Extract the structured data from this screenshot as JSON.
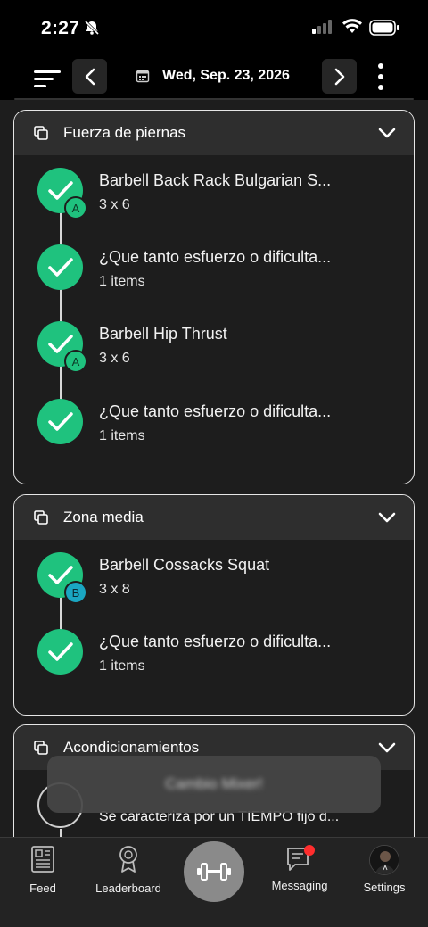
{
  "status_bar": {
    "time": "2:27"
  },
  "nav": {
    "date": "Wed, Sep. 23, 2026"
  },
  "sections": [
    {
      "title": "Fuerza de piernas",
      "exercises": [
        {
          "name": "Barbell Back Rack Bulgarian S...",
          "detail": "3 x 6",
          "badge": "A"
        },
        {
          "name": "¿Que tanto esfuerzo o dificulta...",
          "detail": "1 items",
          "badge": ""
        },
        {
          "name": "Barbell Hip Thrust",
          "detail": "3 x 6",
          "badge": "A"
        },
        {
          "name": "¿Que tanto esfuerzo o dificulta...",
          "detail": "1 items",
          "badge": ""
        }
      ]
    },
    {
      "title": "Zona media",
      "exercises": [
        {
          "name": "Barbell Cossacks Squat",
          "detail": "3 x 8",
          "badge": "B"
        },
        {
          "name": "¿Que tanto esfuerzo o dificulta...",
          "detail": "1 items",
          "badge": ""
        }
      ]
    },
    {
      "title": "Acondicionamientos",
      "exercises": [
        {
          "name": "Se caracteriza por un TIEMPO fijo d...",
          "detail": "",
          "badge": ""
        }
      ]
    }
  ],
  "toast": {
    "text": "Cambio Mixer!"
  },
  "tabbar": {
    "feed": "Feed",
    "leaderboard": "Leaderboard",
    "messaging": "Messaging",
    "settings": "Settings"
  },
  "colors": {
    "accent_green": "#1fc27e",
    "badge_blue": "#1aa6c2",
    "notification_red": "#ff2d2d"
  }
}
